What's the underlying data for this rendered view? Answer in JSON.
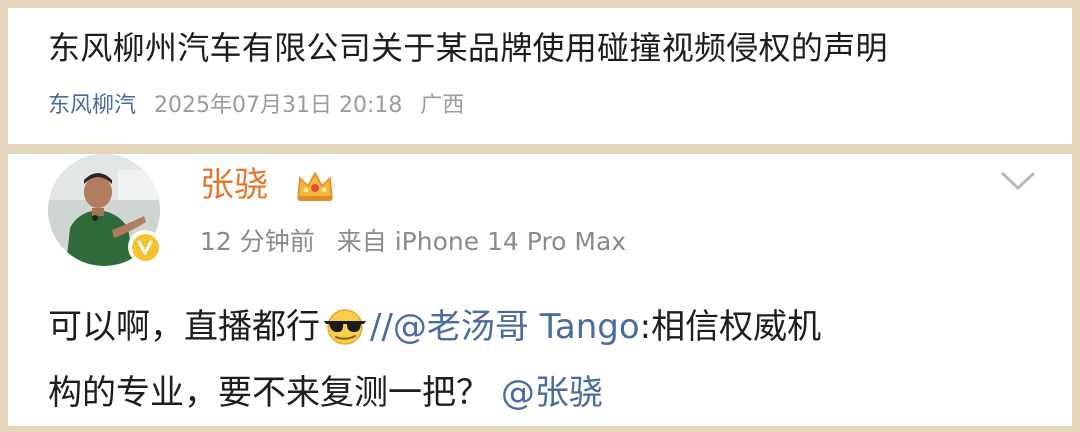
{
  "article": {
    "title": "东风柳州汽车有限公司关于某品牌使用碰撞视频侵权的声明",
    "source": "东风柳汽",
    "datetime": "2025年07月31日 20:18",
    "location": "广西"
  },
  "post": {
    "username": "张骁",
    "time_ago": "12 分钟前",
    "device": "来自 iPhone 14 Pro Max",
    "text_part1": "可以啊，直播都行",
    "repost_sep": "//",
    "mention_user": "@老汤哥 Tango",
    "quoted_part1": ":相信权威机",
    "quoted_part2": "构的专业，要不来复测一把？ ",
    "mention_end": "@张骁"
  },
  "icons": {
    "vip": "crown-vip-icon",
    "verified": "verified-badge-icon",
    "emoji": "sunglasses-emoji-icon",
    "menu": "chevron-down-icon"
  },
  "colors": {
    "background": "#e4d6bb",
    "link": "#4a6b9e",
    "username": "#e0792f",
    "meta": "#8a8a8a",
    "verified": "#f6c22f"
  }
}
